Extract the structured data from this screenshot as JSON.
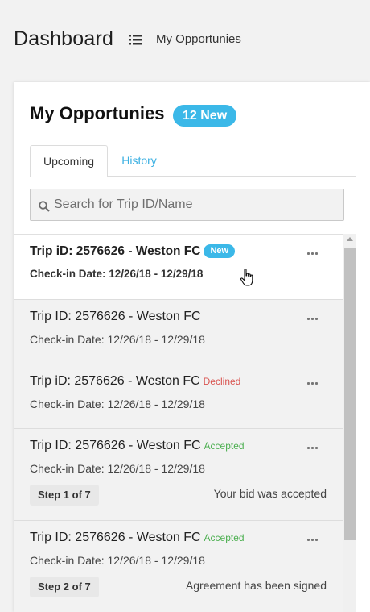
{
  "header": {
    "title": "Dashboard",
    "breadcrumb": "My Opportunies"
  },
  "card": {
    "title": "My Opportunies",
    "new_badge": "12 New",
    "tabs": [
      {
        "label": "Upcoming",
        "active": true
      },
      {
        "label": "History",
        "active": false
      }
    ],
    "search": {
      "placeholder": "Search for Trip ID/Name",
      "value": ""
    }
  },
  "trips": [
    {
      "title": "Trip iD: 2576626 - Weston FC",
      "badge": "New",
      "status": "",
      "checkin": "Check-in Date: 12/26/18 - 12/29/18",
      "step": "",
      "note": ""
    },
    {
      "title": "Trip ID: 2576626 - Weston FC",
      "badge": "",
      "status": "",
      "checkin": "Check-in Date: 12/26/18 - 12/29/18",
      "step": "",
      "note": ""
    },
    {
      "title": "Trip iD: 2576626 - Weston FC",
      "badge": "",
      "status": "Declined",
      "checkin": "Check-in Date: 12/26/18 - 12/29/18",
      "step": "",
      "note": ""
    },
    {
      "title": "Trip ID: 2576626 - Weston FC",
      "badge": "",
      "status": "Accepted",
      "checkin": "Check-in Date: 12/26/18 - 12/29/18",
      "step": "Step 1 of 7",
      "note": "Your bid was accepted"
    },
    {
      "title": "Trip ID: 2576626 - Weston FC",
      "badge": "",
      "status": "Accepted",
      "checkin": "Check-in Date: 12/26/18 - 12/29/18",
      "step": "Step 2 of 7",
      "note": "Agreement has been signed"
    }
  ],
  "colors": {
    "accent": "#3bb8e8",
    "declined": "#d9534f",
    "accepted": "#4caf50"
  },
  "icons": [
    "list-icon",
    "search-icon",
    "more-options-icon",
    "hand-pointer-icon"
  ]
}
